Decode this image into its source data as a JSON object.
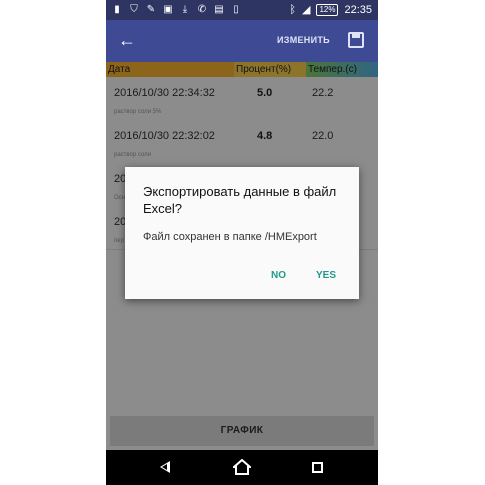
{
  "status_bar": {
    "time": "22:35",
    "battery": "12%",
    "icons": [
      "sim-card-icon",
      "shield-icon",
      "wrench-icon",
      "image-icon",
      "download-icon",
      "phone-icon",
      "message-icon",
      "phone-icon",
      "bluetooth-icon",
      "signal-icon"
    ]
  },
  "app_bar": {
    "edit_label": "ИЗМЕНИТЬ"
  },
  "table": {
    "headers": {
      "date": "Дата",
      "percent": "Процент(%)",
      "temp": "Темпер.(c)"
    },
    "rows": [
      {
        "date": "2016/10/30 22:34:32",
        "percent": "5.0",
        "temp": "22.2",
        "note": "раствор соли 5%"
      },
      {
        "date": "2016/10/30 22:32:02",
        "percent": "4.8",
        "temp": "22.0",
        "note": "раствор соли"
      },
      {
        "date": "20",
        "percent": "",
        "temp": "",
        "note": "Осн"
      },
      {
        "date": "20",
        "percent": "",
        "temp": "",
        "note": "пер"
      }
    ]
  },
  "graph_button": "ГРАФИК",
  "dialog": {
    "title": "Экспортировать данные в файл Excel?",
    "message": "Файл сохранен в папке /HMExport",
    "no": "NO",
    "yes": "YES"
  },
  "colors": {
    "accent": "#1f9a8a",
    "app_bar": "#3f4a95",
    "status_bar": "#2e3563"
  }
}
